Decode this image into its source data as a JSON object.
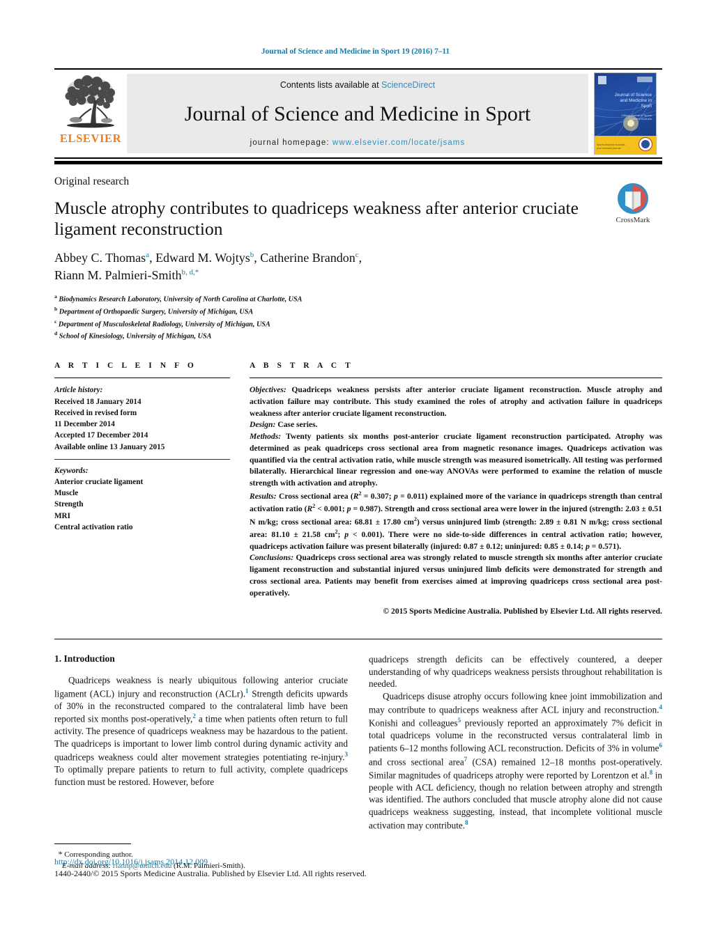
{
  "running_head": "Journal of Science and Medicine in Sport 19 (2016) 7–11",
  "masthead": {
    "publisher_logo_label": "ELSEVIER",
    "contents_prefix": "Contents lists available at ",
    "contents_link": "ScienceDirect",
    "journal_title": "Journal of Science and Medicine in Sport",
    "homepage_prefix": "journal homepage: ",
    "homepage_url": "www.elsevier.com/locate/jsams",
    "cover": {
      "title": "Journal of Science and Medicine in Sport",
      "subtitle": "Official Journal of Sports Medicine Australia",
      "band_text": "Sports Medicine Australia peer reviewed journal"
    }
  },
  "article": {
    "kicker": "Original research",
    "title": "Muscle atrophy contributes to quadriceps weakness after anterior cruciate ligament reconstruction",
    "authors": [
      {
        "name": "Abbey C. Thomas",
        "marks": "a",
        "sep": ", "
      },
      {
        "name": "Edward M. Wojtys",
        "marks": "b",
        "sep": ", "
      },
      {
        "name": "Catherine Brandon",
        "marks": "c",
        "sep": ", "
      },
      {
        "name": "Riann M. Palmieri-Smith",
        "marks": "b, d,",
        "sep": "",
        "star": "*"
      }
    ],
    "affiliations": [
      {
        "mark": "a",
        "text": "Biodynamics Research Laboratory, University of North Carolina at Charlotte, USA"
      },
      {
        "mark": "b",
        "text": "Department of Orthopaedic Surgery, University of Michigan, USA"
      },
      {
        "mark": "c",
        "text": "Department of Musculoskeletal Radiology, University of Michigan, USA"
      },
      {
        "mark": "d",
        "text": "School of Kinesiology, University of Michigan, USA"
      }
    ],
    "crossmark_label": "CrossMark"
  },
  "article_info": {
    "section_label": "A R T I C L E   I N F O",
    "history_label": "Article history:",
    "history": [
      "Received 18 January 2014",
      "Received in revised form",
      "11 December 2014",
      "Accepted 17 December 2014",
      "Available online 13 January 2015"
    ],
    "keywords_label": "Keywords:",
    "keywords": [
      "Anterior cruciate ligament",
      "Muscle",
      "Strength",
      "MRI",
      "Central activation ratio"
    ]
  },
  "abstract": {
    "section_label": "A B S T R A C T",
    "objectives_label": "Objectives:",
    "objectives_text": " Quadriceps weakness persists after anterior cruciate ligament reconstruction. Muscle atrophy and activation failure may contribute. This study examined the roles of atrophy and activation failure in quadriceps weakness after anterior cruciate ligament reconstruction.",
    "design_label": "Design:",
    "design_text": " Case series.",
    "methods_label": "Methods:",
    "methods_text": " Twenty patients six months post-anterior cruciate ligament reconstruction participated. Atrophy was determined as peak quadriceps cross sectional area from magnetic resonance images. Quadriceps activation was quantified via the central activation ratio, while muscle strength was measured isometrically. All testing was performed bilaterally. Hierarchical linear regression and one-way ANOVAs were performed to examine the relation of muscle strength with activation and atrophy.",
    "results_label": "Results:",
    "results_text_1": " Cross sectional area (",
    "results_r2_a": "R",
    "results_text_2": " = 0.307; ",
    "results_p_a": "p",
    "results_text_3": " = 0.011) explained more of the variance in quadriceps strength than central activation ratio (",
    "results_r2_b": "R",
    "results_text_4": " < 0.001; ",
    "results_p_b": "p",
    "results_text_5": " = 0.987). Strength and cross sectional area were lower in the injured (strength: 2.03 ± 0.51 N m/kg; cross sectional area: 68.81 ± 17.80 cm",
    "results_text_6": ") versus uninjured limb (strength: 2.89 ± 0.81 N m/kg; cross sectional area: 81.10 ± 21.58 cm",
    "results_text_7": "; ",
    "results_p_c": "p",
    "results_text_8": " < 0.001). There were no side-to-side differences in central activation ratio; however, quadriceps activation failure was present bilaterally (injured: 0.87 ± 0.12; uninjured: 0.85 ± 0.14; ",
    "results_p_d": "p",
    "results_text_9": " = 0.571).",
    "conclusions_label": "Conclusions:",
    "conclusions_text": " Quadriceps cross sectional area was strongly related to muscle strength six months after anterior cruciate ligament reconstruction and substantial injured versus uninjured limb deficits were demonstrated for strength and cross sectional area. Patients may benefit from exercises aimed at improving quadriceps cross sectional area post-operatively.",
    "copyright": "© 2015 Sports Medicine Australia. Published by Elsevier Ltd. All rights reserved."
  },
  "introduction": {
    "heading": "1. Introduction",
    "left_p1_a": "Quadriceps weakness is nearly ubiquitous following anterior cruciate ligament (ACL) injury and reconstruction (ACLr).",
    "left_p1_ref1": "1",
    "left_p1_b": " Strength deficits upwards of 30% in the reconstructed compared to the contralateral limb have been reported six months post-operatively,",
    "left_p1_ref2": "2",
    "left_p1_c": " a time when patients often return to full activity. The presence of quadriceps weakness may be hazardous to the patient. The quadriceps is important to lower limb control during dynamic activity and quadriceps weakness could alter movement strategies potentiating re-injury.",
    "left_p1_ref3": "3",
    "left_p1_d": " To optimally prepare patients to return to full activity, complete quadriceps function must be restored. However, before",
    "right_p1": "quadriceps strength deficits can be effectively countered, a deeper understanding of why quadriceps weakness persists throughout rehabilitation is needed.",
    "right_p2_a": "Quadriceps disuse atrophy occurs following knee joint immobilization and may contribute to quadriceps weakness after ACL injury and reconstruction.",
    "right_p2_ref4": "4",
    "right_p2_b": " Konishi and colleagues",
    "right_p2_ref5": "5",
    "right_p2_c": " previously reported an approximately 7% deficit in total quadriceps volume in the reconstructed versus contralateral limb in patients 6–12 months following ACL reconstruction. Deficits of 3% in volume",
    "right_p2_ref6": "6",
    "right_p2_d": " and cross sectional area",
    "right_p2_ref7": "7",
    "right_p2_e": " (CSA) remained 12–18 months post-operatively. Similar magnitudes of quadriceps atrophy were reported by Lorentzon et al.",
    "right_p2_ref8": "8",
    "right_p2_f": " in people with ACL deficiency, though no relation between atrophy and strength was identified. The authors concluded that muscle atrophy alone did not cause quadriceps weakness suggesting, instead, that incomplete volitional muscle activation may contribute.",
    "right_p2_ref8b": "8"
  },
  "footnote": {
    "star": "*",
    "corresponding": " Corresponding author.",
    "email_label": "E-mail address:",
    "email": "riannp@umich.edu",
    "email_suffix": " (R.M. Palmieri-Smith)."
  },
  "bottom": {
    "doi": "http://dx.doi.org/10.1016/j.jsams.2014.12.009",
    "issn": "1440-2440/© 2015 Sports Medicine Australia. Published by Elsevier Ltd. All rights reserved."
  },
  "colors": {
    "link": "#1a7ba5",
    "elsevier_orange": "#f07c1a",
    "panel_grey": "#eaeaea"
  }
}
